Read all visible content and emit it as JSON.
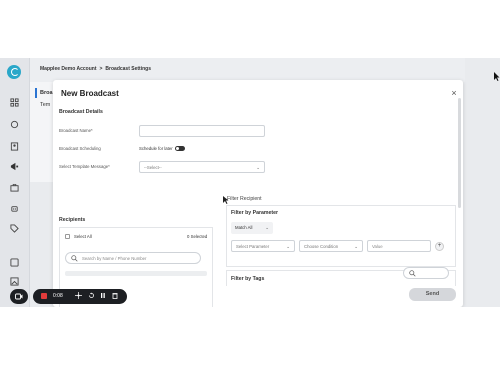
{
  "breadcrumb": {
    "parent": "Mapplee Demo Account",
    "separator": ">",
    "current": "Broadcast Settings"
  },
  "subnav": {
    "items": [
      "Broa",
      "Tem"
    ]
  },
  "modal": {
    "title": "New Broadcast",
    "close_icon": "×",
    "broadcast_details": {
      "section_title": "Broadcast Details",
      "name_label": "Broadcast Name*",
      "name_value": "",
      "scheduling_label": "Broadcast Scheduling",
      "schedule_toggle_label": "Schedule for later",
      "template_label": "Select Template Message*",
      "template_value": "--Select--"
    },
    "filter_recipient": {
      "heading": "Filter Recipient",
      "by_parameter": {
        "title": "Filter by Parameter",
        "match_value": "Match All",
        "parameter_placeholder": "Select Parameter",
        "condition_placeholder": "Choose Condition",
        "value_placeholder": "Value",
        "add_label": "+"
      },
      "by_tags": {
        "title": "Filter by Tags"
      }
    },
    "recipients": {
      "title": "Recipients",
      "select_all_label": "Select All",
      "selected_count": "0 Selected",
      "search_placeholder": "Search by Name / Phone Number"
    },
    "send_label": "Send"
  },
  "recorder": {
    "time": "0:08"
  },
  "colors": {
    "accent": "#2aa7c9",
    "recorder_bg": "#1d1f23",
    "record_red": "#e23b3b"
  },
  "icons": [
    "logo-icon",
    "grid-icon",
    "chat-icon",
    "contacts-icon",
    "megaphone-icon",
    "briefcase-icon",
    "bot-icon",
    "tag-icon",
    "settings-icon",
    "close-icon",
    "search-icon",
    "camera-icon",
    "stop-icon",
    "move-icon",
    "restart-icon",
    "pause-icon",
    "trash-icon"
  ]
}
